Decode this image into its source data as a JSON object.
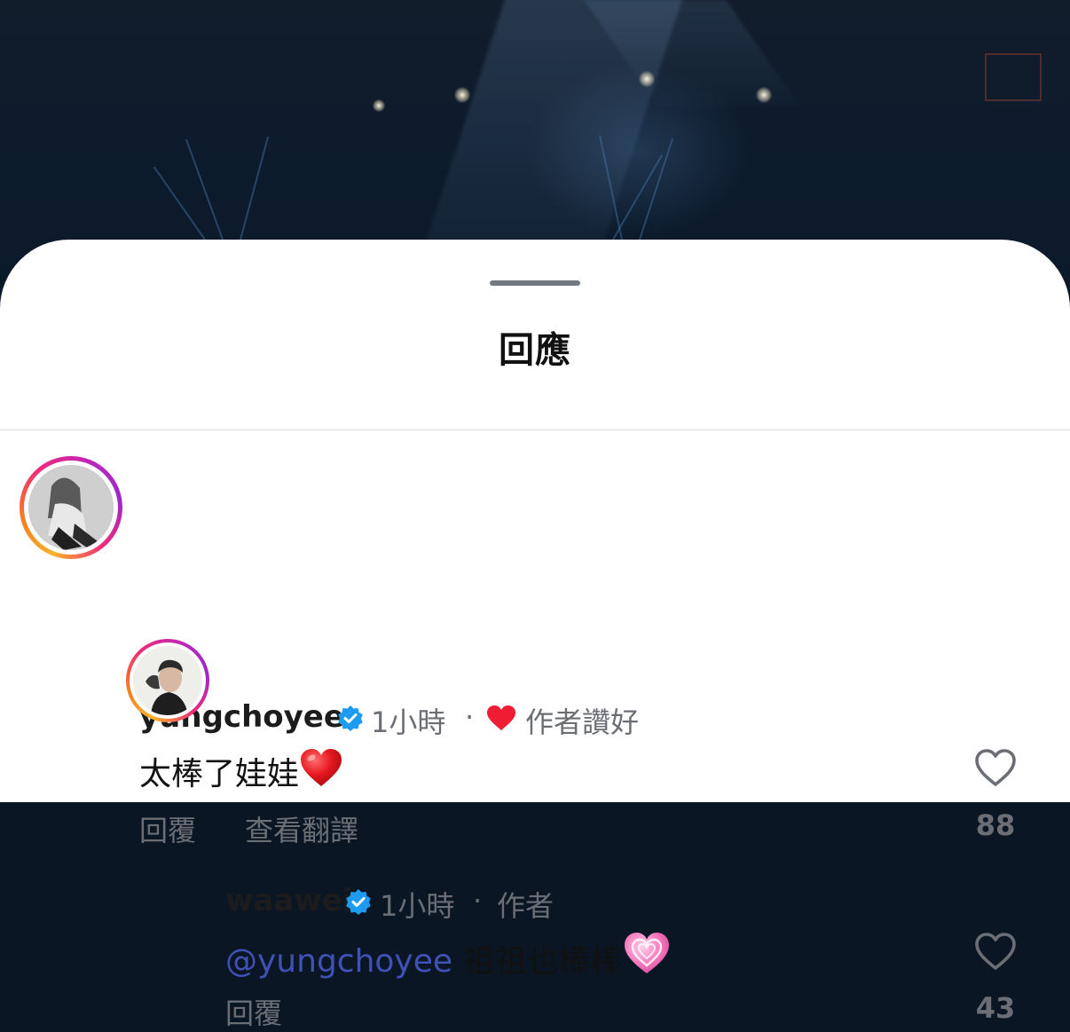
{
  "sheet": {
    "title": "回應"
  },
  "comments": [
    {
      "username": "yungchoyee",
      "verified": true,
      "time": "1小時",
      "separator": "·",
      "author_liked_label": "作者讚好",
      "text": "太棒了娃娃",
      "emoji": "red-heart",
      "actions": {
        "reply": "回覆",
        "translate": "查看翻譯"
      },
      "likes": "88"
    },
    {
      "username": "waawei",
      "verified": true,
      "time": "1小時",
      "separator": "·",
      "author_label": "作者",
      "mention": "@yungchoyee",
      "text": "祖祖也棒棒",
      "emoji": "growing-heart",
      "actions": {
        "reply": "回覆"
      },
      "likes": "43"
    }
  ],
  "colors": {
    "mention": "#3f51b5",
    "verified": "#1d9bf0",
    "author_heart": "#ee1d33",
    "meta_text": "#6b6f75"
  }
}
